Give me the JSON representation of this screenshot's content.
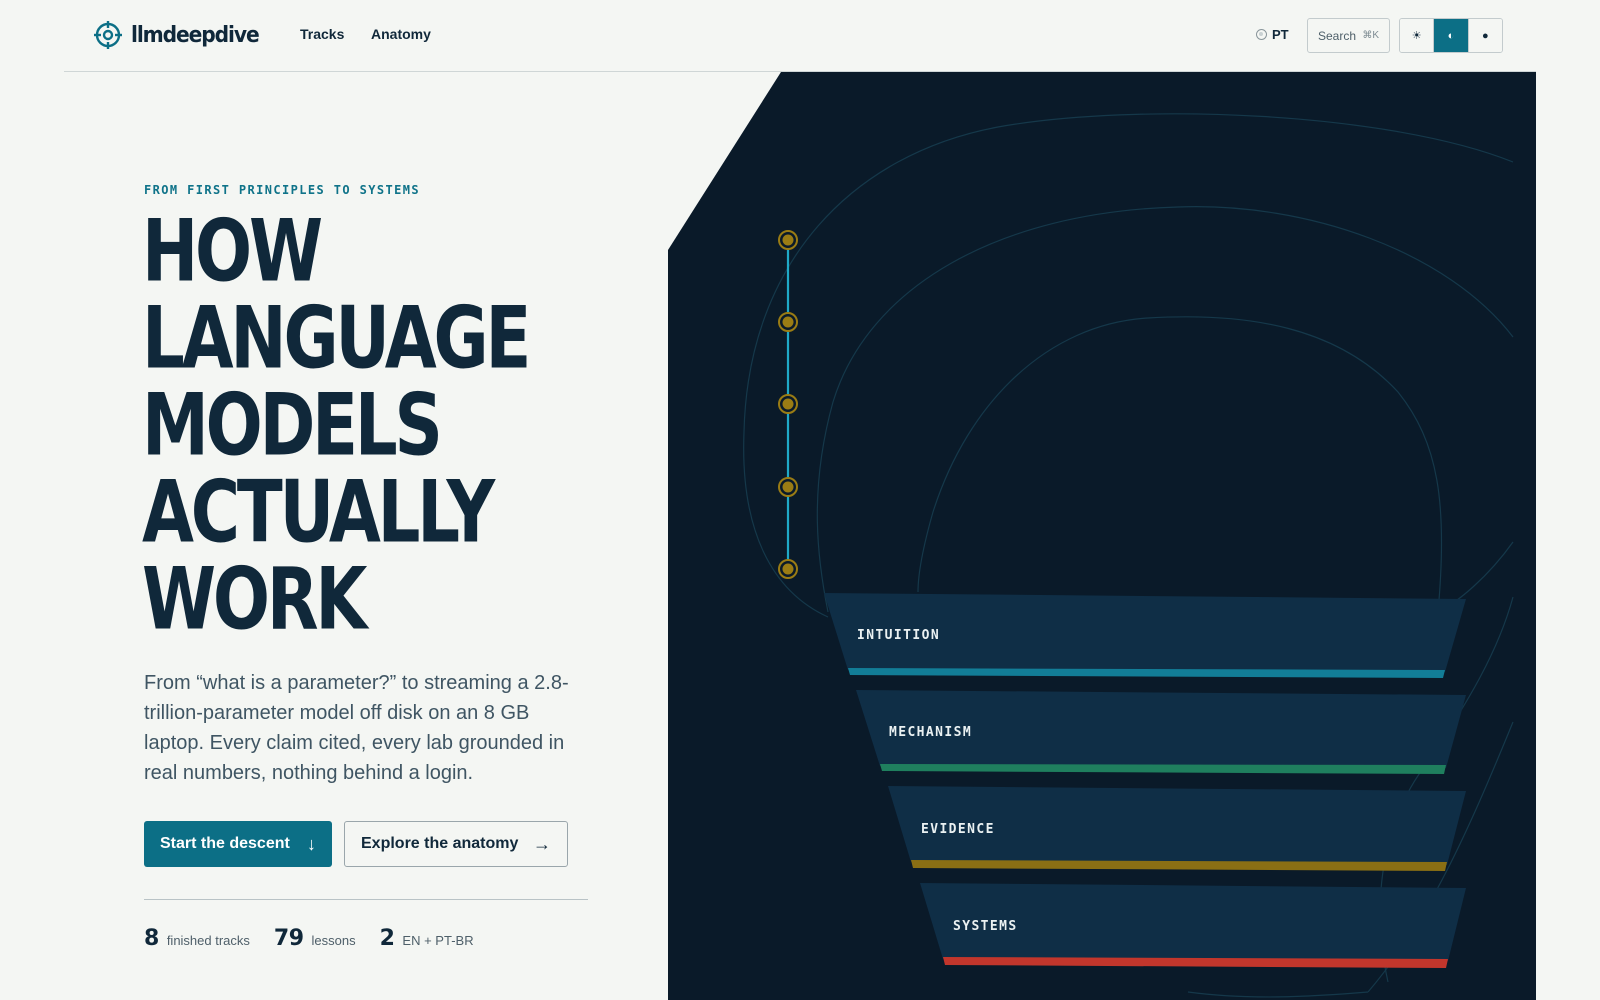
{
  "header": {
    "brand": "llmdeepdive",
    "nav": [
      "Tracks",
      "Anatomy"
    ],
    "lang_toggle": "PT",
    "search": {
      "label": "Search",
      "shortcut": "⌘K"
    },
    "theme_options": [
      {
        "icon": "sun-icon",
        "glyph": "☀",
        "active": false
      },
      {
        "icon": "contrast-icon",
        "glyph": "◐",
        "active": true
      },
      {
        "icon": "moon-icon",
        "glyph": "●",
        "active": false
      }
    ]
  },
  "hero": {
    "eyebrow": "FROM FIRST PRINCIPLES TO SYSTEMS",
    "headline": [
      "HOW",
      "LANGUAGE",
      "MODELS",
      "ACTUALLY",
      "WORK"
    ],
    "lede": "From “what is a parameter?” to streaming a 2.8-trillion-parameter model off disk on an 8 GB laptop. Every claim cited, every lab grounded in real numbers, nothing behind a login.",
    "primary_cta": {
      "label": "Start the descent",
      "arrow": "↓"
    },
    "secondary_cta": {
      "label": "Explore the anatomy",
      "arrow": "→"
    },
    "stats": [
      {
        "value": "8",
        "label": "finished tracks"
      },
      {
        "value": "79",
        "label": "lessons"
      },
      {
        "value": "2",
        "label": "EN + PT-BR"
      }
    ]
  },
  "layers": [
    {
      "name": "INTUITION",
      "color": "#127d97"
    },
    {
      "name": "MECHANISM",
      "color": "#1f7f5e"
    },
    {
      "name": "EVIDENCE",
      "color": "#8a6f14"
    },
    {
      "name": "SYSTEMS",
      "color": "#c2362c"
    }
  ],
  "colors": {
    "accent": "#0c6f86",
    "ink": "#10283a",
    "panel": "#0a1a29",
    "stepper_node": "#9a7c14",
    "stepper_line": "#1fa9c7"
  }
}
